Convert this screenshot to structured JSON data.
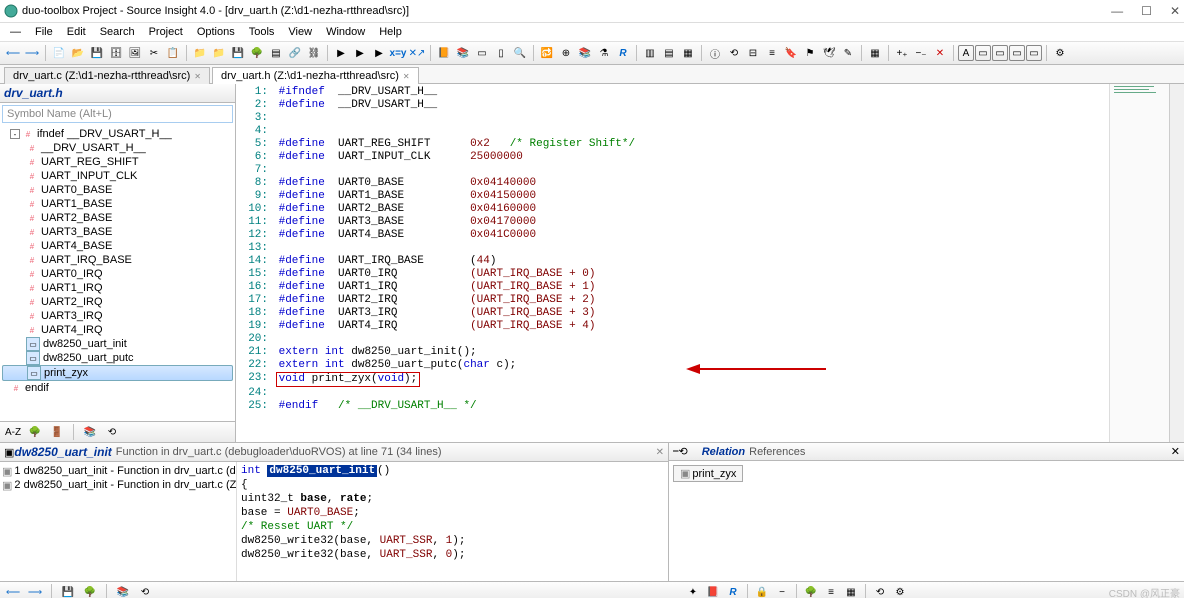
{
  "window": {
    "title": "duo-toolbox Project - Source Insight 4.0 - [drv_uart.h (Z:\\d1-nezha-rtthread\\src)]"
  },
  "menu": [
    "File",
    "Edit",
    "Search",
    "Project",
    "Options",
    "Tools",
    "View",
    "Window",
    "Help"
  ],
  "tabs": [
    {
      "label": "drv_uart.c (Z:\\d1-nezha-rtthread\\src)",
      "active": false
    },
    {
      "label": "drv_uart.h (Z:\\d1-nezha-rtthread\\src)",
      "active": true
    }
  ],
  "sidebar": {
    "file": "drv_uart.h",
    "symbol_placeholder": "Symbol Name (Alt+L)",
    "tree": [
      {
        "icon": "box",
        "label": "ifndef __DRV_USART_H__",
        "lvl": 1,
        "expand": "-"
      },
      {
        "icon": "def",
        "label": "__DRV_USART_H__",
        "lvl": 2
      },
      {
        "icon": "def",
        "label": "UART_REG_SHIFT",
        "lvl": 2
      },
      {
        "icon": "def",
        "label": "UART_INPUT_CLK",
        "lvl": 2
      },
      {
        "icon": "def",
        "label": "UART0_BASE",
        "lvl": 2
      },
      {
        "icon": "def",
        "label": "UART1_BASE",
        "lvl": 2
      },
      {
        "icon": "def",
        "label": "UART2_BASE",
        "lvl": 2
      },
      {
        "icon": "def",
        "label": "UART3_BASE",
        "lvl": 2
      },
      {
        "icon": "def",
        "label": "UART4_BASE",
        "lvl": 2
      },
      {
        "icon": "def",
        "label": "UART_IRQ_BASE",
        "lvl": 2
      },
      {
        "icon": "def",
        "label": "UART0_IRQ",
        "lvl": 2
      },
      {
        "icon": "def",
        "label": "UART1_IRQ",
        "lvl": 2
      },
      {
        "icon": "def",
        "label": "UART2_IRQ",
        "lvl": 2
      },
      {
        "icon": "def",
        "label": "UART3_IRQ",
        "lvl": 2
      },
      {
        "icon": "def",
        "label": "UART4_IRQ",
        "lvl": 2
      },
      {
        "icon": "fn",
        "label": "dw8250_uart_init",
        "lvl": 2
      },
      {
        "icon": "fn",
        "label": "dw8250_uart_putc",
        "lvl": 2
      },
      {
        "icon": "fn2",
        "label": "print_zyx",
        "lvl": 2,
        "sel": true
      },
      {
        "icon": "def",
        "label": "endif",
        "lvl": 1
      }
    ]
  },
  "code": [
    {
      "n": 1,
      "html": "<span class='pp'>#ifndef</span>  __DRV_USART_H__"
    },
    {
      "n": 2,
      "html": "<span class='pp'>#define</span>  __DRV_USART_H__"
    },
    {
      "n": 3,
      "html": ""
    },
    {
      "n": 4,
      "html": ""
    },
    {
      "n": 5,
      "html": "<span class='pp'>#define</span>  UART_REG_SHIFT      <span class='num'>0x2</span>   <span class='cmt'>/* Register Shift*/</span>"
    },
    {
      "n": 6,
      "html": "<span class='pp'>#define</span>  UART_INPUT_CLK      <span class='num'>25000000</span>"
    },
    {
      "n": 7,
      "html": ""
    },
    {
      "n": 8,
      "html": "<span class='pp'>#define</span>  UART0_BASE          <span class='num'>0x04140000</span>"
    },
    {
      "n": 9,
      "html": "<span class='pp'>#define</span>  UART1_BASE          <span class='num'>0x04150000</span>"
    },
    {
      "n": 10,
      "html": "<span class='pp'>#define</span>  UART2_BASE          <span class='num'>0x04160000</span>"
    },
    {
      "n": 11,
      "html": "<span class='pp'>#define</span>  UART3_BASE          <span class='num'>0x04170000</span>"
    },
    {
      "n": 12,
      "html": "<span class='pp'>#define</span>  UART4_BASE          <span class='num'>0x041C0000</span>"
    },
    {
      "n": 13,
      "html": ""
    },
    {
      "n": 14,
      "html": "<span class='pp'>#define</span>  UART_IRQ_BASE       (<span class='num'>44</span>)"
    },
    {
      "n": 15,
      "html": "<span class='pp'>#define</span>  UART0_IRQ           <span class='num'>(UART_IRQ_BASE + 0)</span>"
    },
    {
      "n": 16,
      "html": "<span class='pp'>#define</span>  UART1_IRQ           <span class='num'>(UART_IRQ_BASE + 1)</span>"
    },
    {
      "n": 17,
      "html": "<span class='pp'>#define</span>  UART2_IRQ           <span class='num'>(UART_IRQ_BASE + 2)</span>"
    },
    {
      "n": 18,
      "html": "<span class='pp'>#define</span>  UART3_IRQ           <span class='num'>(UART_IRQ_BASE + 3)</span>"
    },
    {
      "n": 19,
      "html": "<span class='pp'>#define</span>  UART4_IRQ           <span class='num'>(UART_IRQ_BASE + 4)</span>"
    },
    {
      "n": 20,
      "html": ""
    },
    {
      "n": 21,
      "html": "<span class='kw'>extern</span> <span class='kw'>int</span> dw8250_uart_init();"
    },
    {
      "n": 22,
      "html": "<span class='kw'>extern</span> <span class='kw'>int</span> dw8250_uart_putc(<span class='kw'>char</span> c);"
    },
    {
      "n": 23,
      "html": "<span class='highlight-box'><span class='kw'>void</span> print_zyx(<span class='kw'>void</span>);</span>"
    },
    {
      "n": 24,
      "html": ""
    },
    {
      "n": 25,
      "html": "<span class='pp'>#endif</span>   <span class='cmt'>/* __DRV_USART_H__ */</span>"
    }
  ],
  "context": {
    "title": "dw8250_uart_init",
    "info": "Function in drv_uart.c (debugloader\\duoRVOS) at line 71 (34 lines)",
    "list": [
      "1 dw8250_uart_init - Function in drv_uart.c (de",
      "2 dw8250_uart_init - Function in drv_uart.c (Z:"
    ],
    "code": [
      "<span class='kw'>int</span> <span class='func-hl'>dw8250_uart_init</span>()",
      "{",
      "    uint32_t <b>base</b>, <b>rate</b>;",
      "",
      "    base = <span style='color:#800000'>UART0_BASE</span>;",
      "",
      "    <span class='cmt'>/* Resset UART */</span>",
      "    dw8250_write32(base, <span style='color:#800000'>UART_SSR</span>, <span class='num'>1</span>);",
      "    dw8250_write32(base, <span style='color:#800000'>UART_SSR</span>, <span class='num'>0</span>);"
    ]
  },
  "relation": {
    "title": "Relation",
    "sub": "References",
    "item": "print_zyx"
  },
  "watermark": "CSDN @风正豪"
}
